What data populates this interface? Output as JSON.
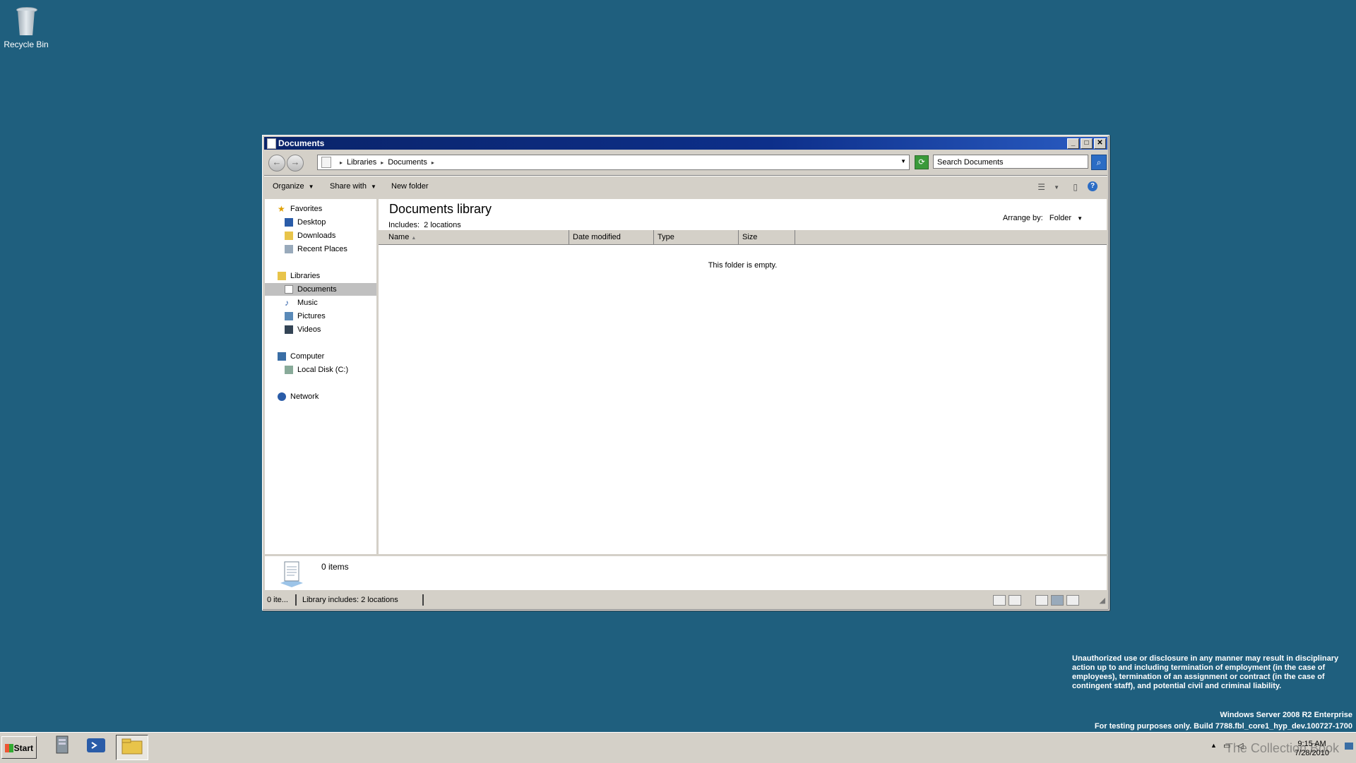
{
  "desktop": {
    "recycle_bin": "Recycle Bin"
  },
  "window": {
    "title": "Documents",
    "address": {
      "crumbs": [
        "Libraries",
        "Documents"
      ]
    },
    "search_placeholder": "Search Documents",
    "toolbar": {
      "organize": "Organize",
      "share_with": "Share with",
      "new_folder": "New folder"
    },
    "nav": {
      "favorites": "Favorites",
      "favorites_items": [
        "Desktop",
        "Downloads",
        "Recent Places"
      ],
      "libraries": "Libraries",
      "libraries_items": [
        "Documents",
        "Music",
        "Pictures",
        "Videos"
      ],
      "selected": "Documents",
      "computer": "Computer",
      "computer_items": [
        "Local Disk (C:)"
      ],
      "network": "Network"
    },
    "main": {
      "title": "Documents library",
      "includes_label": "Includes:",
      "includes_value": "2 locations",
      "arrange_label": "Arrange by:",
      "arrange_value": "Folder",
      "columns": [
        "Name",
        "Date modified",
        "Type",
        "Size"
      ],
      "empty_text": "This folder is empty."
    },
    "details": {
      "items": "0 items"
    },
    "status": {
      "left": "0 ite...",
      "library": "Library includes:  2 locations"
    }
  },
  "notice": "Unauthorized use or disclosure in any manner may result in disciplinary action up to and including termination of employment (in the case of employees), termination of an assignment or contract (in the case of contingent staff), and potential civil and criminal liability.",
  "build": {
    "edition": "Windows Server 2008 R2 Enterprise",
    "line": "For testing purposes only. Build 7788.fbl_core1_hyp_dev.100727-1700"
  },
  "taskbar": {
    "start": "Start",
    "clock_time": "9:15 AM",
    "clock_date": "7/28/2010",
    "watermark": "The Collection Book"
  },
  "colors": {
    "desktop": "#1f5f7e",
    "titlebar": "#0a246a",
    "chrome": "#d4d0c8"
  }
}
